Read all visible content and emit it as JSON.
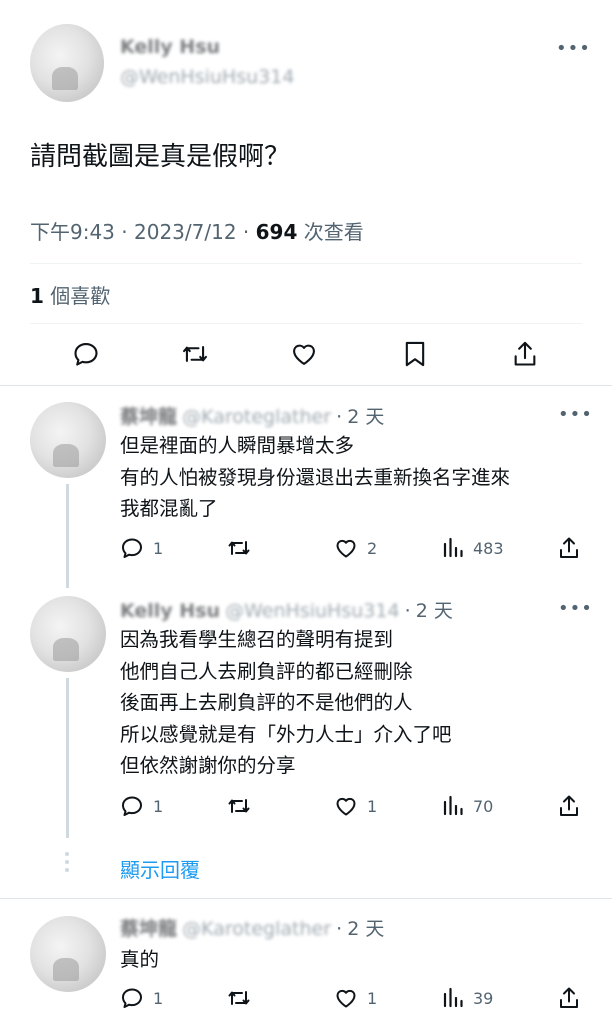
{
  "main_tweet": {
    "author_name": "Kelly Hsu",
    "author_handle": "@WenHsiuHsu314",
    "text": "請問截圖是真是假啊？",
    "time": "下午9:43",
    "date": "2023/7/12",
    "views_count": "694",
    "views_label": "次查看",
    "likes_count": "1",
    "likes_label": "個喜歡"
  },
  "replies": [
    {
      "author_name": "蔡坤龍",
      "author_handle": "@Karoteglather",
      "time_ago": "2 天",
      "lines": [
        "但是裡面的人瞬間暴增太多",
        "有的人怕被發現身份還退出去重新換名字進來",
        "我都混亂了"
      ],
      "replies": "1",
      "likes": "2",
      "views": "483"
    },
    {
      "author_name": "Kelly Hsu",
      "author_handle": "@WenHsiuHsu314",
      "time_ago": "2 天",
      "lines": [
        "因為我看學生總召的聲明有提到",
        "他們自己人去刷負評的都已經刪除",
        "後面再上去刷負評的不是他們的人",
        "所以感覺就是有「外力人士」介入了吧",
        "但依然謝謝你的分享"
      ],
      "replies": "1",
      "likes": "1",
      "views": "70"
    },
    {
      "author_name": "蔡坤龍",
      "author_handle": "@Karoteglather",
      "time_ago": "2 天",
      "lines": [
        "真的"
      ],
      "replies": "1",
      "likes": "1",
      "views": "39"
    }
  ],
  "show_replies_label": "顯示回覆",
  "separator": "·",
  "more_label": "•••",
  "colors": {
    "accent": "#1d9bf0",
    "text": "#0f1419",
    "muted": "#536471",
    "divider": "#eff3f4"
  }
}
